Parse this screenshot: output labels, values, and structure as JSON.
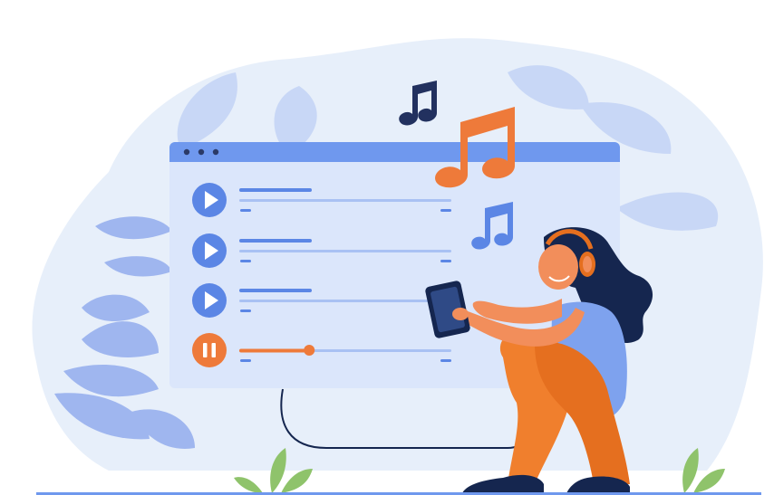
{
  "colors": {
    "background": "#ffffff",
    "blob": "#e7effa",
    "leaf_dark": "#9fb6ef",
    "leaf_light": "#c8d7f6",
    "window": "#dbe6fb",
    "window_bar": "#6f98ee",
    "window_dots": "#2b3a67",
    "accent_blue": "#5b86e5",
    "accent_orange": "#ee7a3a",
    "note_navy": "#22315f",
    "skin": "#f28e5b",
    "hair": "#15264f",
    "shirt": "#7ea2ee",
    "pants": "#f07f2d",
    "shoe": "#15264f",
    "ground_plant": "#8fc36b"
  },
  "player": {
    "tracks": [
      {
        "state": "play",
        "progress": 0
      },
      {
        "state": "play",
        "progress": 0
      },
      {
        "state": "play",
        "progress": 0
      },
      {
        "state": "pause",
        "progress": 0.33
      }
    ]
  },
  "icons": [
    "play-icon",
    "pause-icon",
    "music-note-icon",
    "headphones-icon",
    "smartphone-icon"
  ]
}
